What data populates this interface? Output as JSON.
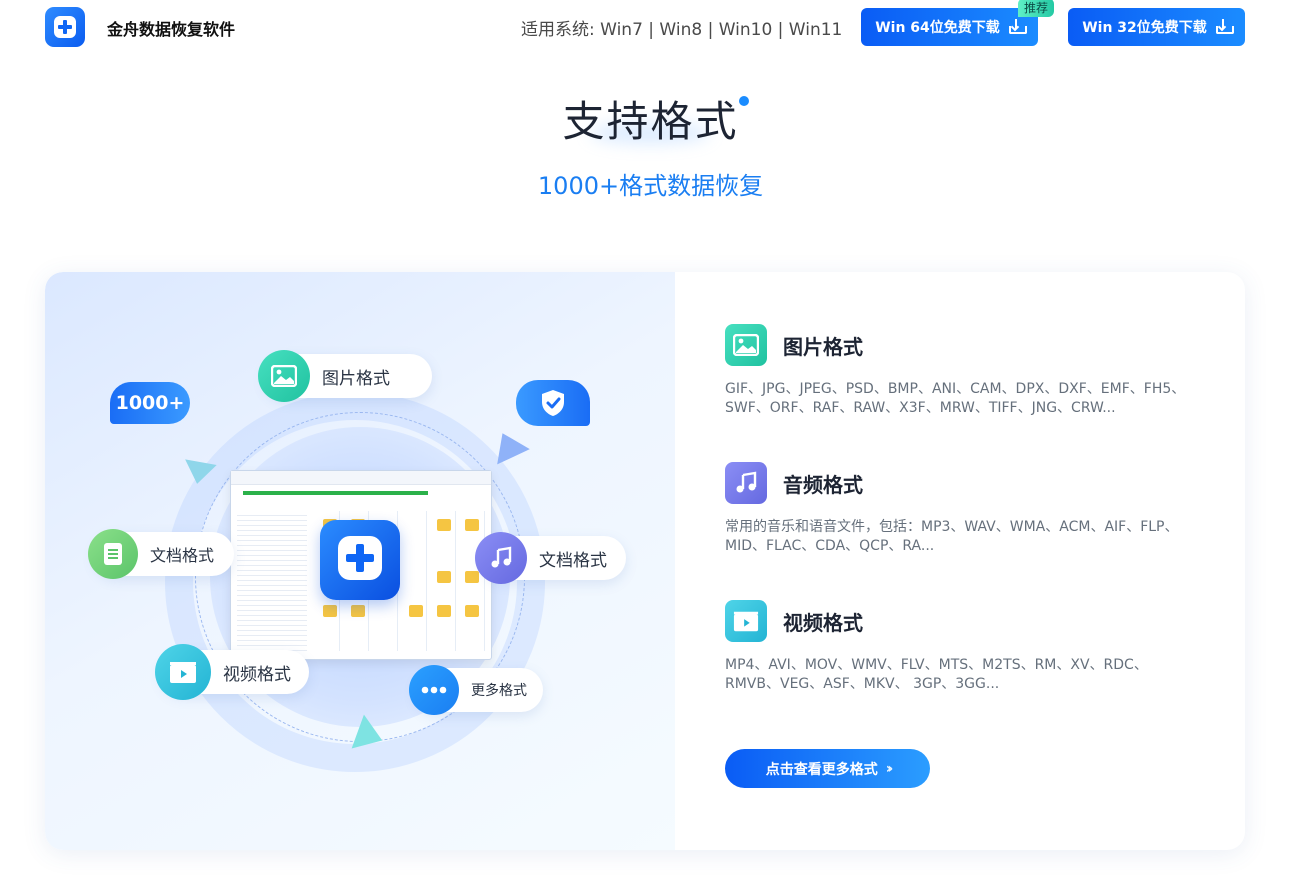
{
  "header": {
    "brand": "金舟数据恢复软件",
    "systems": "适用系统: Win7 | Win8 | Win10 | Win11",
    "download64": "Win 64位免费下载",
    "download32": "Win 32位免费下载",
    "recommend_badge": "推荐"
  },
  "hero": {
    "title": "支持格式",
    "subtitle": "1000+格式数据恢复"
  },
  "illustration": {
    "tag_count": "1000+",
    "pill_image": "图片格式",
    "pill_doc": "文档格式",
    "pill_audio": "文档格式",
    "pill_video": "视频格式",
    "pill_more": "更多格式"
  },
  "formats": [
    {
      "name": "图片格式",
      "icon": "image-icon",
      "desc": "GIF、JPG、JPEG、PSD、BMP、ANI、CAM、DPX、DXF、EMF、FH5、SWF、ORF、RAF、RAW、X3F、MRW、TIFF、JNG、CRW..."
    },
    {
      "name": "音频格式",
      "icon": "music-icon",
      "desc": "常用的音乐和语音文件，包括：MP3、WAV、WMA、ACM、AIF、FLP、MID、FLAC、CDA、QCP、RA..."
    },
    {
      "name": "视频格式",
      "icon": "video-icon",
      "desc": "MP4、AVI、MOV、WMV、FLV、MTS、M2TS、RM、XV、RDC、RMVB、VEG、ASF、MKV、 3GP、3GG..."
    }
  ],
  "more_button": "点击查看更多格式",
  "colors": {
    "accent": "#0a5cf5",
    "subtitle": "#1a7ef2",
    "teal": "#20c2a0",
    "purple": "#6569e0",
    "cyan": "#23b4d4"
  }
}
